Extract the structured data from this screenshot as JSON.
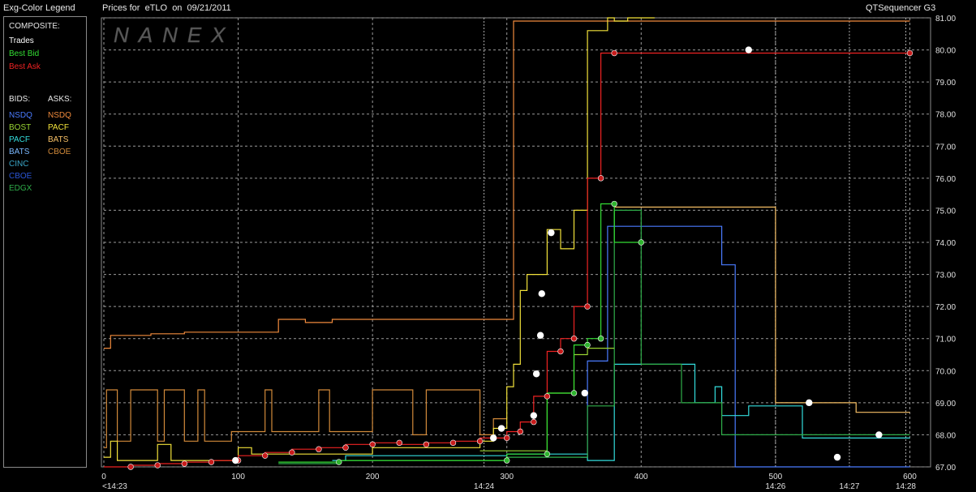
{
  "header": {
    "legend_title": "Exg-Color Legend",
    "chart_title": "Prices for  eTLO  on  09/21/2011",
    "app_name": "QTSequencer G3"
  },
  "watermark": "NANEX",
  "legend": {
    "composite_label": "COMPOSITE:",
    "composite": [
      {
        "label": "Trades",
        "color": "#ffffff"
      },
      {
        "label": "Best Bid",
        "color": "#33dd33"
      },
      {
        "label": "Best Ask",
        "color": "#ee2222"
      }
    ],
    "bids_label": "BIDS:",
    "asks_label": "ASKS:",
    "bids": [
      {
        "label": "NSDQ",
        "color": "#4a7bff"
      },
      {
        "label": "BOST",
        "color": "#99d433"
      },
      {
        "label": "PACF",
        "color": "#33dddd"
      },
      {
        "label": "BATS",
        "color": "#7ab8ff"
      },
      {
        "label": "CINC",
        "color": "#3aa6c8"
      },
      {
        "label": "CBOE",
        "color": "#2b56d8"
      },
      {
        "label": "EDGX",
        "color": "#2fae4a"
      }
    ],
    "asks": [
      {
        "label": "NSDQ",
        "color": "#f08a3c"
      },
      {
        "label": "PACF",
        "color": "#f2e23a"
      },
      {
        "label": "BATS",
        "color": "#f7c066"
      },
      {
        "label": "CBOE",
        "color": "#d28a3a"
      }
    ]
  },
  "chart_data": {
    "type": "line",
    "title": "Prices for  eTLO  on  09/21/2011",
    "grid": true,
    "xlim": [
      0,
      610
    ],
    "ylim": [
      67.0,
      81.0
    ],
    "y_ticks": [
      "67.00",
      "68.00",
      "69.00",
      "70.00",
      "71.00",
      "72.00",
      "73.00",
      "74.00",
      "75.00",
      "76.00",
      "77.00",
      "78.00",
      "79.00",
      "80.00",
      "81.00"
    ],
    "x_ticks": [
      0,
      100,
      200,
      300,
      400,
      500,
      600
    ],
    "x_time_labels": [
      {
        "x": 0,
        "label": "<14:23"
      },
      {
        "x": 283,
        "label": "14:24"
      },
      {
        "x": 500,
        "label": "14:26"
      },
      {
        "x": 555,
        "label": "14:27"
      },
      {
        "x": 597,
        "label": "14:28"
      }
    ],
    "series": [
      {
        "name": "NSDQ Ask",
        "color": "#f08a3c",
        "x": [
          0,
          5,
          5,
          35,
          35,
          60,
          60,
          100,
          100,
          130,
          130,
          150,
          150,
          170,
          170,
          200,
          200,
          280,
          280,
          300,
          300,
          305,
          305,
          600,
          600
        ],
        "y": [
          70.7,
          70.7,
          71.1,
          71.1,
          71.15,
          71.15,
          71.2,
          71.2,
          71.2,
          71.2,
          71.6,
          71.6,
          71.5,
          71.5,
          71.6,
          71.6,
          71.6,
          71.6,
          71.6,
          71.6,
          71.6,
          71.6,
          80.9,
          80.9,
          80.9
        ]
      },
      {
        "name": "CBOE Ask",
        "color": "#d28a3a",
        "x": [
          0,
          2,
          2,
          10,
          10,
          20,
          20,
          40,
          40,
          45,
          45,
          60,
          60,
          70,
          70,
          75,
          75,
          95,
          95,
          120,
          120,
          125,
          125,
          160,
          160,
          168,
          168,
          200,
          200,
          230,
          230,
          240,
          240,
          280,
          280,
          290,
          290,
          300
        ],
        "y": [
          67.6,
          67.6,
          69.4,
          69.4,
          67.8,
          67.8,
          69.4,
          69.4,
          67.8,
          67.8,
          69.4,
          69.4,
          67.8,
          67.8,
          69.4,
          69.4,
          67.8,
          67.8,
          68.1,
          68.1,
          69.4,
          69.4,
          68.1,
          68.1,
          69.4,
          69.4,
          68.1,
          68.1,
          69.4,
          69.4,
          68.0,
          68.0,
          69.4,
          69.4,
          68.0,
          68.0,
          68.5,
          68.5
        ]
      },
      {
        "name": "PACF Ask",
        "color": "#f2e23a",
        "x": [
          0,
          5,
          5,
          10,
          10,
          40,
          40,
          50,
          50,
          100,
          100,
          110,
          110,
          200,
          200,
          280,
          280,
          290,
          290,
          300,
          300,
          305,
          305,
          310,
          310,
          315,
          315,
          330,
          330,
          340,
          340,
          350,
          350,
          360,
          360,
          375,
          375,
          380,
          380,
          390,
          390,
          410
        ],
        "y": [
          67.3,
          67.3,
          67.8,
          67.8,
          67.2,
          67.2,
          67.7,
          67.7,
          67.2,
          67.2,
          67.6,
          67.6,
          67.4,
          67.4,
          67.6,
          67.6,
          67.8,
          67.8,
          68.2,
          68.2,
          69.5,
          69.5,
          70.2,
          70.2,
          72.5,
          72.5,
          73.0,
          73.0,
          74.4,
          74.4,
          73.8,
          73.8,
          75.0,
          75.0,
          80.6,
          80.6,
          81.0,
          81.0,
          80.9,
          80.9,
          81.0,
          81.0
        ]
      },
      {
        "name": "BATS Ask",
        "color": "#f7c066",
        "x": [
          380,
          386,
          386,
          500,
          500,
          520,
          520,
          560,
          560,
          600
        ],
        "y": [
          75.1,
          75.1,
          75.1,
          75.1,
          69.0,
          69.0,
          69.0,
          69.0,
          68.7,
          68.7
        ]
      },
      {
        "name": "NSDQ Bid",
        "color": "#4a7bff",
        "x": [
          355,
          360,
          360,
          375,
          375,
          395,
          395,
          460,
          460,
          470,
          470,
          600
        ],
        "y": [
          67.3,
          67.3,
          70.3,
          70.3,
          74.5,
          74.5,
          74.5,
          74.5,
          73.3,
          73.3,
          67.0,
          67.0
        ]
      },
      {
        "name": "PACF Bid",
        "color": "#33dddd",
        "x": [
          170,
          180,
          180,
          300,
          300,
          360,
          360,
          380,
          380,
          440,
          440,
          455,
          455,
          460,
          460,
          480,
          480,
          520,
          520,
          600
        ],
        "y": [
          67.2,
          67.2,
          67.35,
          67.35,
          67.4,
          67.4,
          67.2,
          67.2,
          70.2,
          70.2,
          69.0,
          69.0,
          69.5,
          69.5,
          68.6,
          68.6,
          68.9,
          68.9,
          67.9,
          67.9
        ]
      },
      {
        "name": "EDGX Bid",
        "color": "#2fae4a",
        "x": [
          130,
          175,
          175,
          300,
          300,
          360,
          360,
          380,
          380,
          400,
          400,
          430,
          430,
          460,
          460,
          600
        ],
        "y": [
          67.1,
          67.1,
          67.2,
          67.2,
          67.3,
          67.3,
          68.9,
          68.9,
          75.0,
          75.0,
          70.2,
          70.2,
          69.0,
          69.0,
          68.0,
          68.0
        ]
      },
      {
        "name": "BOST Bid",
        "color": "#99d433",
        "x": [
          280,
          300,
          300,
          330,
          330,
          350,
          350,
          360,
          360,
          380
        ],
        "y": [
          67.5,
          67.5,
          67.5,
          67.5,
          69.3,
          69.3,
          70.5,
          70.5,
          70.7,
          70.7
        ]
      },
      {
        "name": "Best Ask",
        "color": "#ee2222",
        "x": [
          0,
          20,
          20,
          40,
          40,
          60,
          60,
          80,
          80,
          100,
          100,
          120,
          120,
          140,
          140,
          160,
          160,
          180,
          180,
          200,
          200,
          220,
          220,
          240,
          240,
          260,
          260,
          280,
          280,
          300,
          300,
          310,
          310,
          320,
          320,
          330,
          330,
          340,
          340,
          350,
          350,
          360,
          360,
          370,
          370,
          380,
          380,
          600
        ],
        "y": [
          67.0,
          67.0,
          67.05,
          67.05,
          67.1,
          67.1,
          67.15,
          67.15,
          67.2,
          67.2,
          67.35,
          67.35,
          67.45,
          67.45,
          67.55,
          67.55,
          67.6,
          67.6,
          67.7,
          67.7,
          67.75,
          67.75,
          67.7,
          67.7,
          67.75,
          67.75,
          67.8,
          67.8,
          67.9,
          67.9,
          68.1,
          68.1,
          68.4,
          68.4,
          69.2,
          69.2,
          70.6,
          70.6,
          71.0,
          71.0,
          72.0,
          72.0,
          76.0,
          76.0,
          79.9,
          79.9,
          79.9,
          79.9
        ]
      },
      {
        "name": "Best Bid",
        "color": "#33dd33",
        "x": [
          130,
          175,
          175,
          300,
          300,
          330,
          330,
          350,
          350,
          360,
          360,
          370,
          370,
          380,
          380,
          400
        ],
        "y": [
          67.15,
          67.15,
          67.2,
          67.2,
          67.4,
          67.4,
          69.3,
          69.3,
          70.8,
          70.8,
          71.0,
          71.0,
          75.2,
          75.2,
          74.0,
          74.0
        ]
      },
      {
        "name": "Trades",
        "color": "#ffffff",
        "type": "scatter",
        "x": [
          98,
          290,
          296,
          320,
          322,
          325,
          326,
          333,
          358,
          480,
          525,
          546,
          577
        ],
        "y": [
          67.2,
          67.9,
          68.2,
          68.6,
          69.9,
          71.1,
          72.4,
          74.3,
          69.3,
          80.0,
          69.0,
          67.3,
          68.0
        ]
      }
    ]
  }
}
